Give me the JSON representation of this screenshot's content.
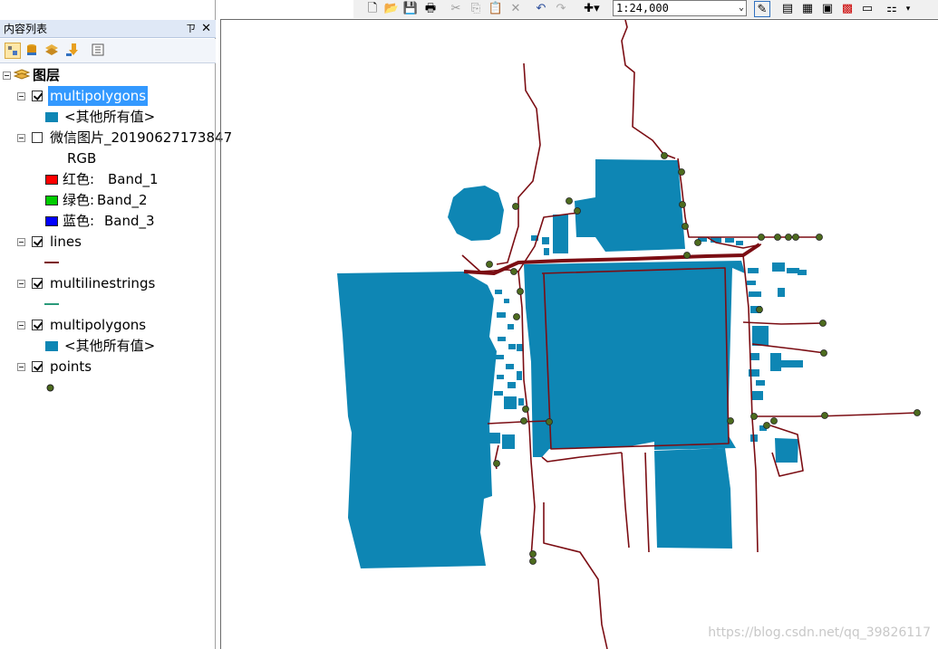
{
  "toc": {
    "title": "内容列表",
    "pin": "ㄗ",
    "close": "✕",
    "root_label": "图层",
    "layers": [
      {
        "name": "multipolygons",
        "legend": "<其他所有值>"
      },
      {
        "name": "微信图片_20190627173847",
        "band_header": "RGB",
        "bands": [
          {
            "label": "红色:",
            "value": "Band_1"
          },
          {
            "label": "绿色:",
            "value": "Band_2"
          },
          {
            "label": "蓝色:",
            "value": "Band_3"
          }
        ]
      },
      {
        "name": "lines"
      },
      {
        "name": "multilinestrings"
      },
      {
        "name": "multipolygons",
        "legend": "<其他所有值>"
      },
      {
        "name": "points"
      }
    ]
  },
  "toolbar": {
    "scale": "1:24,000",
    "scale_dropdown": "⌄"
  },
  "colors": {
    "polygon_fill": "#0e86b4",
    "line": "#7b0d13",
    "point": "#4d6b1e",
    "selection": "#3399ff",
    "band_red": "#ff0000",
    "band_green": "#00cc00",
    "band_blue": "#0000ff"
  },
  "watermark": "https://blog.csdn.net/qq_39826117"
}
